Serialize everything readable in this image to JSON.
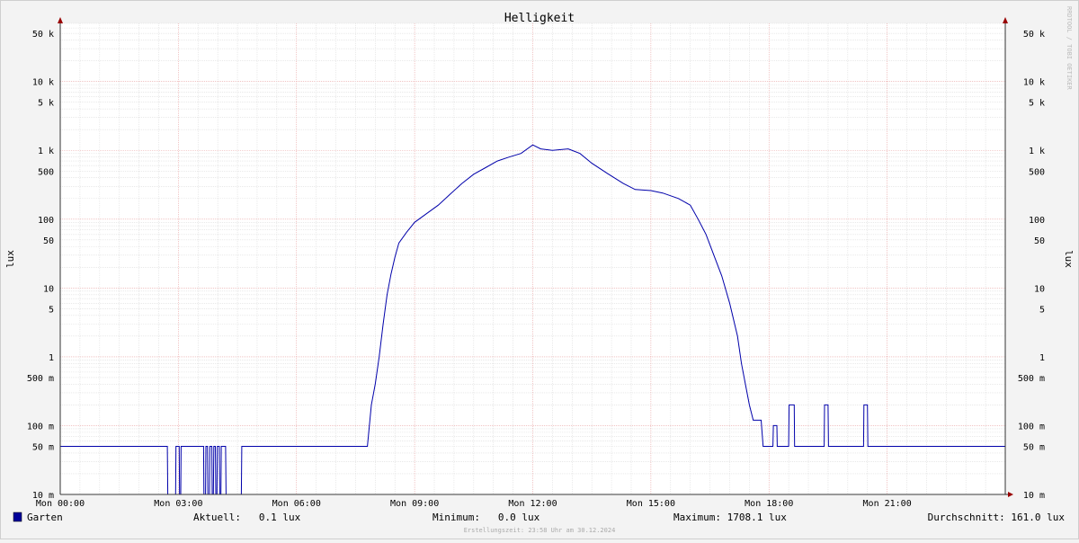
{
  "chart_data": {
    "type": "line",
    "title": "Helligkeit",
    "ylabel": "lux",
    "ylabel_right": "lux",
    "watermark": "RRDTOOL / TOBI OETIKER",
    "y_scale": "log",
    "ylim": [
      0.01,
      70000
    ],
    "xlim_hours": [
      0,
      24
    ],
    "grid": true,
    "y_ticks": [
      {
        "value": 50000,
        "label": "50 k"
      },
      {
        "value": 10000,
        "label": "10 k"
      },
      {
        "value": 5000,
        "label": "5 k"
      },
      {
        "value": 1000,
        "label": "1 k"
      },
      {
        "value": 500,
        "label": "500"
      },
      {
        "value": 100,
        "label": "100"
      },
      {
        "value": 50,
        "label": "50"
      },
      {
        "value": 10,
        "label": "10"
      },
      {
        "value": 5,
        "label": "5"
      },
      {
        "value": 1,
        "label": "1"
      },
      {
        "value": 0.5,
        "label": "500 m"
      },
      {
        "value": 0.1,
        "label": "100 m"
      },
      {
        "value": 0.05,
        "label": "50 m"
      },
      {
        "value": 0.01,
        "label": "10 m"
      }
    ],
    "x_ticks": [
      {
        "hour": 0,
        "label": "Mon 00:00"
      },
      {
        "hour": 3,
        "label": "Mon 03:00"
      },
      {
        "hour": 6,
        "label": "Mon 06:00"
      },
      {
        "hour": 9,
        "label": "Mon 09:00"
      },
      {
        "hour": 12,
        "label": "Mon 12:00"
      },
      {
        "hour": 15,
        "label": "Mon 15:00"
      },
      {
        "hour": 18,
        "label": "Mon 18:00"
      },
      {
        "hour": 21,
        "label": "Mon 21:00"
      }
    ],
    "series": [
      {
        "name": "Garten",
        "color": "#0000aa",
        "points": [
          [
            0.0,
            0.05
          ],
          [
            2.72,
            0.05
          ],
          [
            2.73,
            0.01
          ],
          [
            2.93,
            0.01
          ],
          [
            2.94,
            0.05
          ],
          [
            3.02,
            0.05
          ],
          [
            3.03,
            0.01
          ],
          [
            3.06,
            0.01
          ],
          [
            3.07,
            0.05
          ],
          [
            3.64,
            0.05
          ],
          [
            3.65,
            0.01
          ],
          [
            3.69,
            0.01
          ],
          [
            3.7,
            0.05
          ],
          [
            3.74,
            0.05
          ],
          [
            3.75,
            0.01
          ],
          [
            3.79,
            0.01
          ],
          [
            3.8,
            0.05
          ],
          [
            3.85,
            0.05
          ],
          [
            3.86,
            0.01
          ],
          [
            3.89,
            0.01
          ],
          [
            3.9,
            0.05
          ],
          [
            3.94,
            0.05
          ],
          [
            3.95,
            0.01
          ],
          [
            3.98,
            0.01
          ],
          [
            3.99,
            0.05
          ],
          [
            4.04,
            0.05
          ],
          [
            4.05,
            0.01
          ],
          [
            4.08,
            0.01
          ],
          [
            4.09,
            0.05
          ],
          [
            4.2,
            0.05
          ],
          [
            4.21,
            0.01
          ],
          [
            4.6,
            0.01
          ],
          [
            4.61,
            0.05
          ],
          [
            7.8,
            0.05
          ],
          [
            7.85,
            0.1
          ],
          [
            7.9,
            0.2
          ],
          [
            8.0,
            0.4
          ],
          [
            8.1,
            1
          ],
          [
            8.2,
            3
          ],
          [
            8.3,
            8
          ],
          [
            8.4,
            16
          ],
          [
            8.5,
            28
          ],
          [
            8.6,
            45
          ],
          [
            8.8,
            65
          ],
          [
            9.0,
            90
          ],
          [
            9.3,
            120
          ],
          [
            9.6,
            160
          ],
          [
            9.9,
            230
          ],
          [
            10.2,
            330
          ],
          [
            10.5,
            450
          ],
          [
            10.8,
            560
          ],
          [
            11.1,
            700
          ],
          [
            11.4,
            800
          ],
          [
            11.7,
            900
          ],
          [
            12.0,
            1200
          ],
          [
            12.2,
            1050
          ],
          [
            12.5,
            1000
          ],
          [
            12.9,
            1050
          ],
          [
            13.2,
            900
          ],
          [
            13.5,
            650
          ],
          [
            13.9,
            460
          ],
          [
            14.3,
            330
          ],
          [
            14.6,
            270
          ],
          [
            15.0,
            260
          ],
          [
            15.3,
            240
          ],
          [
            15.7,
            200
          ],
          [
            16.0,
            160
          ],
          [
            16.2,
            100
          ],
          [
            16.4,
            60
          ],
          [
            16.6,
            30
          ],
          [
            16.8,
            15
          ],
          [
            17.0,
            6
          ],
          [
            17.2,
            2
          ],
          [
            17.3,
            0.8
          ],
          [
            17.4,
            0.4
          ],
          [
            17.5,
            0.2
          ],
          [
            17.6,
            0.12
          ],
          [
            17.8,
            0.12
          ],
          [
            17.85,
            0.05
          ],
          [
            18.1,
            0.05
          ],
          [
            18.11,
            0.1
          ],
          [
            18.2,
            0.1
          ],
          [
            18.21,
            0.05
          ],
          [
            18.5,
            0.05
          ],
          [
            18.51,
            0.2
          ],
          [
            18.64,
            0.2
          ],
          [
            18.65,
            0.05
          ],
          [
            19.4,
            0.05
          ],
          [
            19.41,
            0.2
          ],
          [
            19.5,
            0.2
          ],
          [
            19.51,
            0.05
          ],
          [
            20.4,
            0.05
          ],
          [
            20.41,
            0.2
          ],
          [
            20.5,
            0.2
          ],
          [
            20.51,
            0.05
          ],
          [
            24.0,
            0.05
          ]
        ]
      }
    ],
    "legend": {
      "placement": "bottom-left",
      "label": "Garten",
      "color": "#000099"
    },
    "stats": {
      "current": "Aktuell:   0.1 lux",
      "minimum": "Minimum:   0.0 lux",
      "maximum": "Maximum: 1708.1 lux",
      "average": "Durchschnitt: 161.0 lux"
    },
    "footer": "Erstellungszeit: 23:58 Uhr am 30.12.2024"
  }
}
